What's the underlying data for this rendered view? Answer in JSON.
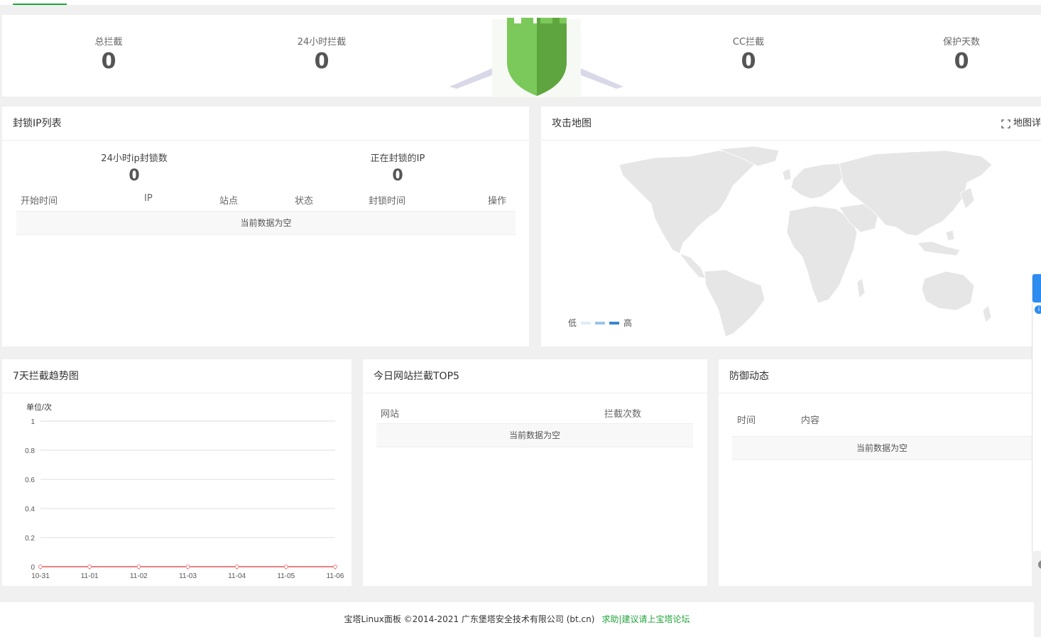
{
  "stats": {
    "total": {
      "label": "总拦截",
      "value": "0"
    },
    "day": {
      "label": "24小时拦截",
      "value": "0"
    },
    "cc": {
      "label": "CC拦截",
      "value": "0"
    },
    "days": {
      "label": "保护天数",
      "value": "0"
    }
  },
  "ip_panel": {
    "title": "封锁IP列表",
    "stat1": {
      "label": "24小时ip封锁数",
      "value": "0"
    },
    "stat2": {
      "label": "正在封锁的IP",
      "value": "0"
    },
    "columns": [
      "开始时间",
      "IP",
      "站点",
      "状态",
      "封锁时间",
      "操作"
    ],
    "empty": "当前数据为空"
  },
  "map_panel": {
    "title": "攻击地图",
    "detail": "地图详",
    "legend_low": "低",
    "legend_high": "高",
    "legend_colors": [
      "#e0ecf8",
      "#9cc3e8",
      "#3a86cc"
    ]
  },
  "trend_panel": {
    "title": "7天拦截趋势图"
  },
  "chart_data": {
    "type": "line",
    "ylabel": "单位/次",
    "x": [
      "10-31",
      "11-01",
      "11-02",
      "11-03",
      "11-04",
      "11-05",
      "11-06"
    ],
    "series": [
      {
        "values": [
          0,
          0,
          0,
          0,
          0,
          0,
          0
        ],
        "color": "#f08080"
      }
    ],
    "ylim": [
      0,
      1
    ],
    "yticks": [
      "0",
      "0.2",
      "0.4",
      "0.6",
      "0.8",
      "1"
    ],
    "grid": true
  },
  "top5_panel": {
    "title": "今日网站拦截TOP5",
    "columns": [
      "网站",
      "拦截次数"
    ],
    "empty": "当前数据为空"
  },
  "defense_panel": {
    "title": "防御动态",
    "columns": [
      "时间",
      "内容"
    ],
    "empty": "当前数据为空"
  },
  "footer": {
    "text": "宝塔Linux面板 ©2014-2021 广东堡塔安全技术有限公司 (bt.cn)",
    "link": "求助|建议请上宝塔论坛"
  },
  "colors": {
    "brand": "#20a53a",
    "shield": "#6dbf4f"
  }
}
